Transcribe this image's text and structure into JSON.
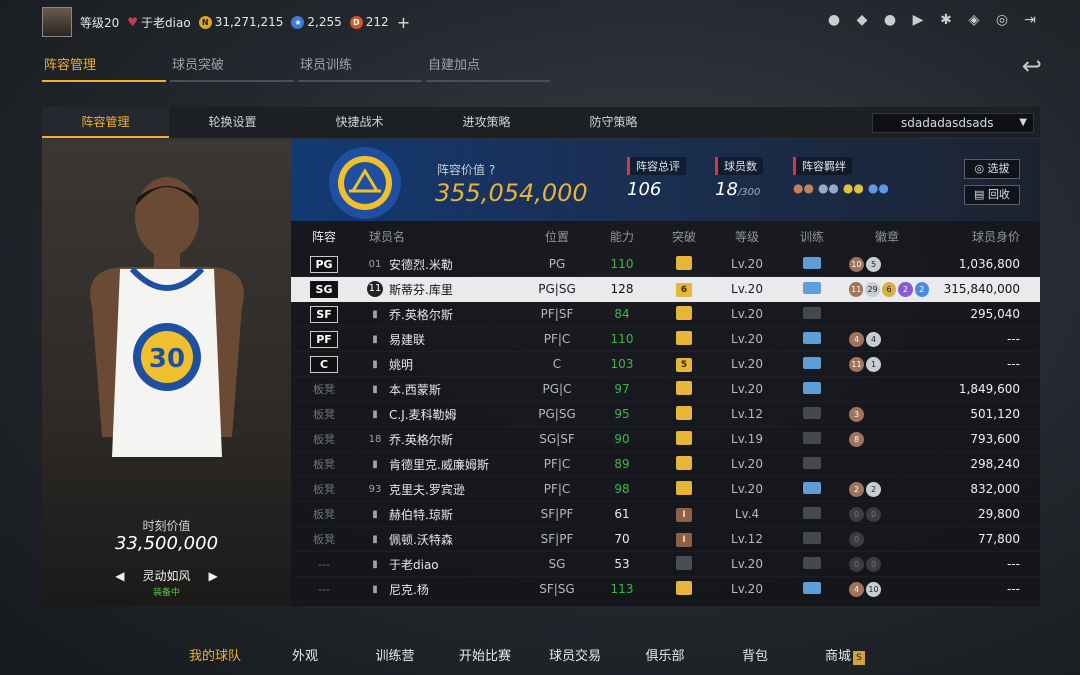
{
  "topbar": {
    "level": "等级20",
    "username": "于老diao",
    "gold": "31,271,215",
    "stars": "2,255",
    "tickets": "212",
    "plus": "+"
  },
  "main_tabs": [
    "阵容管理",
    "球员突破",
    "球员训练",
    "自建加点"
  ],
  "sub_tabs": [
    "阵容管理",
    "轮换设置",
    "快捷战术",
    "进攻策略",
    "防守策略"
  ],
  "lineup_select": "sdadadasdsads",
  "left_card": {
    "value_label": "时刻价值",
    "value": "33,500,000",
    "skill": "灵动如风",
    "equipped": "装备中"
  },
  "team": {
    "value_label": "阵容价值",
    "value": "355,054,000",
    "rating_label": "阵容总评",
    "rating": "106",
    "count_label": "球员数",
    "count": "18",
    "count_max": "/300",
    "bond_label": "阵容羁绊",
    "btn_select": "选拔",
    "btn_recycle": "回收"
  },
  "table_headers": [
    "阵容",
    "球员名",
    "位置",
    "能力",
    "突破",
    "等级",
    "训练",
    "徽章",
    "球员身价"
  ],
  "rows": [
    {
      "slot": "PG",
      "num": "01",
      "name": "安德烈.米勒",
      "pos": "PG",
      "ability": "110",
      "ab": "green",
      "bt": "",
      "btc": "gold",
      "lv": "Lv.20",
      "tr": "on",
      "badges": [
        [
          "br",
          "10"
        ],
        [
          "sv",
          "5"
        ]
      ],
      "value": "1,036,800"
    },
    {
      "slot": "SG",
      "num": "11",
      "name": "斯蒂芬.库里",
      "pos": "PG|SG",
      "ability": "128",
      "ab": "white",
      "bt": "6",
      "btc": "gold",
      "lv": "Lv.20",
      "tr": "on",
      "badges": [
        [
          "br",
          "11"
        ],
        [
          "sv",
          "29"
        ],
        [
          "gd",
          "6"
        ],
        [
          "pp",
          "2"
        ],
        [
          "bl",
          "2"
        ]
      ],
      "value": "315,840,000"
    },
    {
      "slot": "SF",
      "num": "",
      "name": "乔.英格尔斯",
      "pos": "PF|SF",
      "ability": "84",
      "ab": "green",
      "bt": "",
      "btc": "gold",
      "lv": "Lv.20",
      "tr": "off",
      "badges": [],
      "value": "295,040"
    },
    {
      "slot": "PF",
      "num": "",
      "name": "易建联",
      "pos": "PF|C",
      "ability": "110",
      "ab": "green",
      "bt": "",
      "btc": "gold",
      "lv": "Lv.20",
      "tr": "on",
      "badges": [
        [
          "br",
          "4"
        ],
        [
          "sv",
          "4"
        ]
      ],
      "value": "---"
    },
    {
      "slot": "C",
      "num": "",
      "name": "姚明",
      "pos": "C",
      "ability": "103",
      "ab": "green",
      "bt": "5",
      "btc": "gold",
      "lv": "Lv.20",
      "tr": "on",
      "badges": [
        [
          "br",
          "11"
        ],
        [
          "sv",
          "1"
        ]
      ],
      "value": "---"
    },
    {
      "slot": "板凳",
      "num": "",
      "name": "本.西蒙斯",
      "pos": "PG|C",
      "ability": "97",
      "ab": "green",
      "bt": "",
      "btc": "gold",
      "lv": "Lv.20",
      "tr": "on",
      "badges": [],
      "value": "1,849,600"
    },
    {
      "slot": "板凳",
      "num": "",
      "name": "C.J.麦科勒姆",
      "pos": "PG|SG",
      "ability": "95",
      "ab": "green",
      "bt": "",
      "btc": "gold",
      "lv": "Lv.12",
      "tr": "off",
      "badges": [
        [
          "br",
          "3"
        ]
      ],
      "value": "501,120"
    },
    {
      "slot": "板凳",
      "num": "18",
      "name": "乔.英格尔斯",
      "pos": "SG|SF",
      "ability": "90",
      "ab": "green",
      "bt": "",
      "btc": "gold",
      "lv": "Lv.19",
      "tr": "off",
      "badges": [
        [
          "br",
          "8"
        ]
      ],
      "value": "793,600"
    },
    {
      "slot": "板凳",
      "num": "",
      "name": "肯德里克.威廉姆斯",
      "pos": "PF|C",
      "ability": "89",
      "ab": "green",
      "bt": "",
      "btc": "gold",
      "lv": "Lv.20",
      "tr": "off",
      "badges": [],
      "value": "298,240"
    },
    {
      "slot": "板凳",
      "num": "93",
      "name": "克里夫.罗宾逊",
      "pos": "PF|C",
      "ability": "98",
      "ab": "green",
      "bt": "",
      "btc": "gold",
      "lv": "Lv.20",
      "tr": "on",
      "badges": [
        [
          "br",
          "2"
        ],
        [
          "sv",
          "2"
        ]
      ],
      "value": "832,000"
    },
    {
      "slot": "板凳",
      "num": "",
      "name": "赫伯特.琼斯",
      "pos": "SF|PF",
      "ability": "61",
      "ab": "white",
      "bt": "I",
      "btc": "brown",
      "lv": "Lv.4",
      "tr": "off",
      "badges": [
        [
          "dk",
          "0"
        ],
        [
          "dk",
          "0"
        ]
      ],
      "value": "29,800"
    },
    {
      "slot": "板凳",
      "num": "",
      "name": "佩顿.沃特森",
      "pos": "SF|PF",
      "ability": "70",
      "ab": "white",
      "bt": "I",
      "btc": "brown",
      "lv": "Lv.12",
      "tr": "off",
      "badges": [
        [
          "dk",
          "0"
        ]
      ],
      "value": "77,800"
    },
    {
      "slot": "---",
      "num": "",
      "name": "于老diao",
      "pos": "SG",
      "ability": "53",
      "ab": "white",
      "bt": "",
      "btc": "dark",
      "lv": "Lv.20",
      "tr": "off",
      "badges": [
        [
          "dk",
          "0"
        ],
        [
          "dk",
          "0"
        ]
      ],
      "value": "---"
    },
    {
      "slot": "---",
      "num": "",
      "name": "尼克.杨",
      "pos": "SF|SG",
      "ability": "113",
      "ab": "green",
      "bt": "",
      "btc": "gold",
      "lv": "Lv.20",
      "tr": "on",
      "badges": [
        [
          "br",
          "4"
        ],
        [
          "sv",
          "10"
        ]
      ],
      "value": "---"
    }
  ],
  "bottom_nav": [
    "我的球队",
    "外观",
    "训练营",
    "开始比赛",
    "球员交易",
    "俱乐部",
    "背包",
    "商城"
  ],
  "colors": {
    "accent": "#f0b02c",
    "positive": "#3fb64a",
    "team_blue": "#123a73"
  }
}
